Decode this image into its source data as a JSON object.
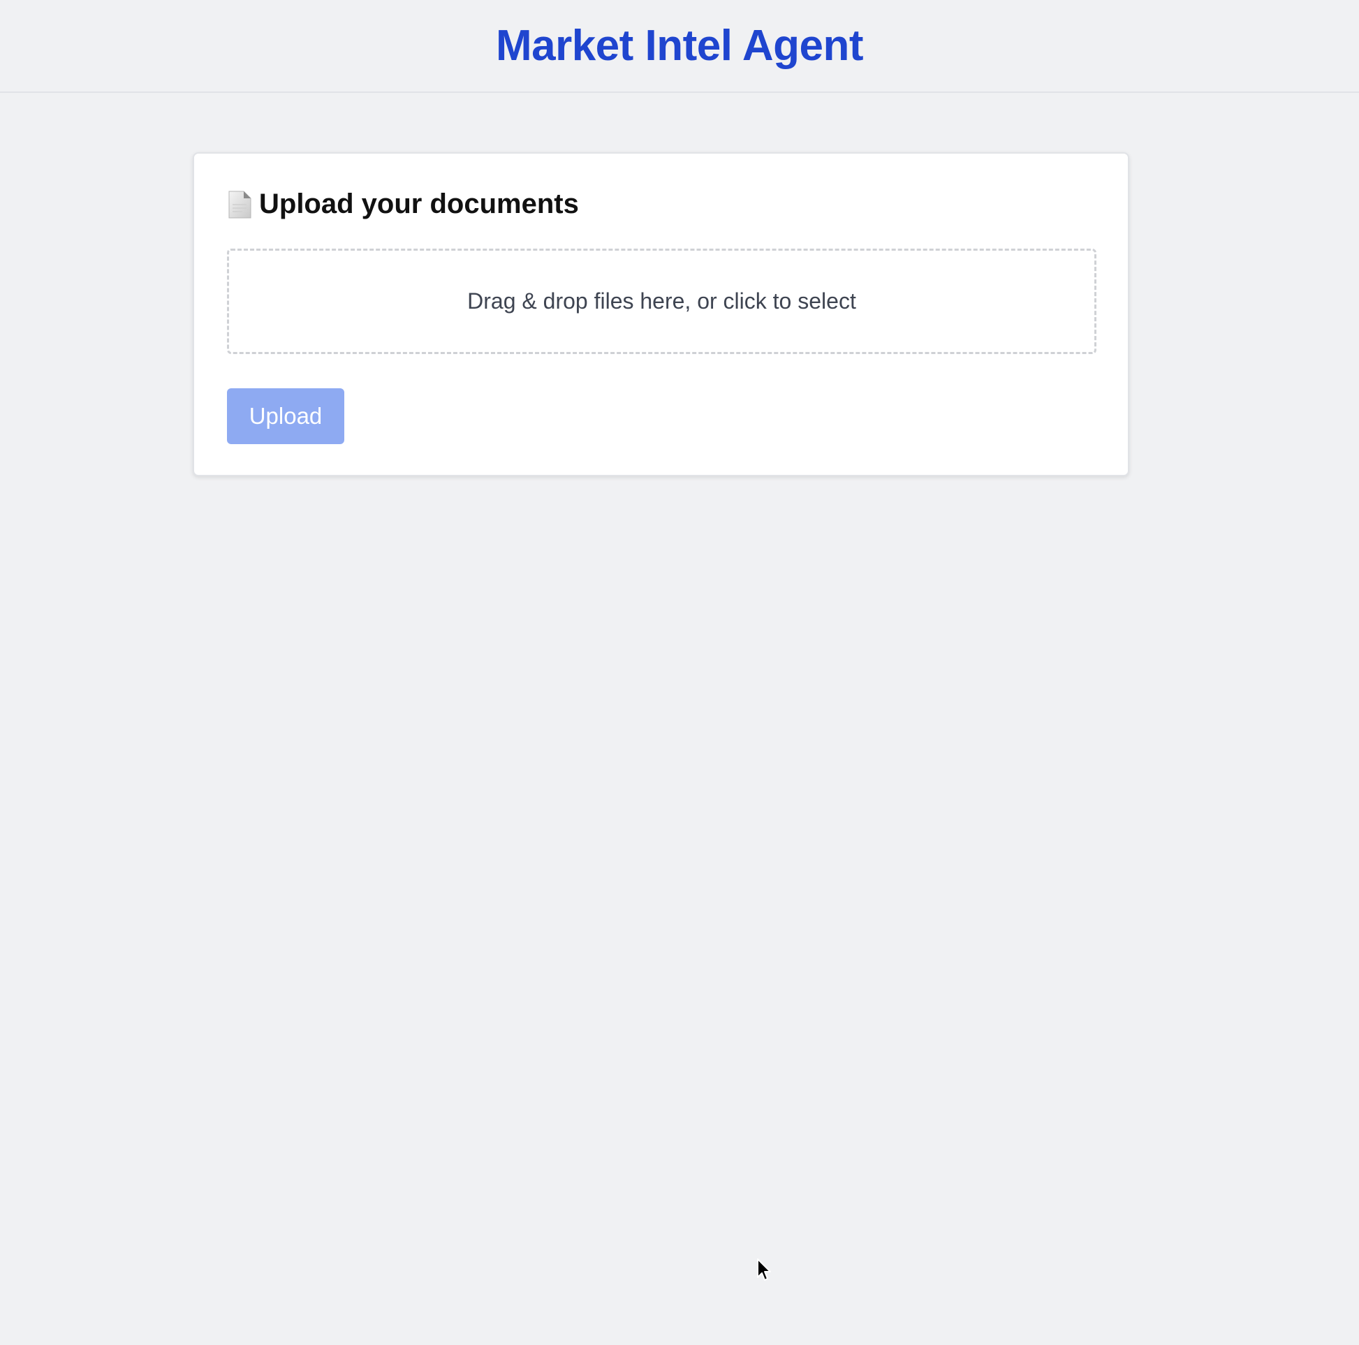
{
  "header": {
    "title": "Market Intel Agent"
  },
  "upload_card": {
    "icon": "document-icon",
    "heading": "Upload your documents",
    "dropzone_text": "Drag & drop files here, or click to select",
    "upload_button_label": "Upload",
    "upload_button_disabled": true
  },
  "colors": {
    "accent": "#1f45cf",
    "button_disabled_bg": "#8eaaf2",
    "page_background": "#f0f1f3"
  }
}
